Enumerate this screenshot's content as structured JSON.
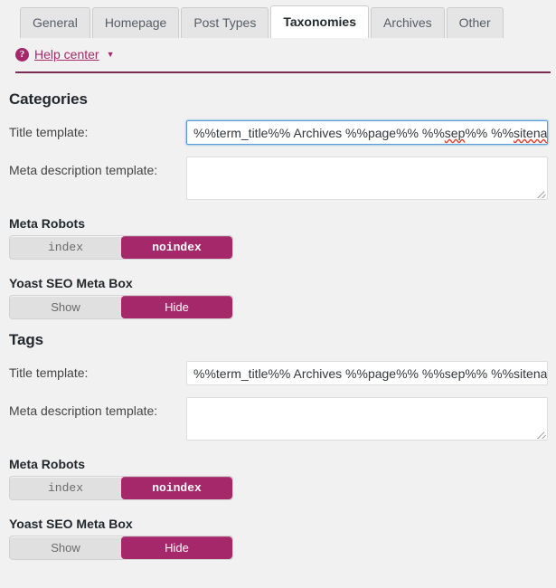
{
  "tabs": [
    {
      "label": "General",
      "active": false
    },
    {
      "label": "Homepage",
      "active": false
    },
    {
      "label": "Post Types",
      "active": false
    },
    {
      "label": "Taxonomies",
      "active": true
    },
    {
      "label": "Archives",
      "active": false
    },
    {
      "label": "Other",
      "active": false
    }
  ],
  "help": {
    "icon": "question-mark-circle-icon",
    "label": "Help center",
    "caret": "▼"
  },
  "colors": {
    "accent": "#a4286a",
    "rule": "#7b2a54",
    "focus_border": "#5b9dd9",
    "page_bg": "#f1f1f1"
  },
  "sections": [
    {
      "id": "categories",
      "title": "Categories",
      "title_template": {
        "label": "Title template:",
        "value_head": "%%term_title%% Archives %%page%% %%",
        "value_sep": "sep",
        "value_mid": "%% %%",
        "value_tail": "sitenam",
        "full_value": "%%term_title%% Archives %%page%% %%sep%% %%sitename%%",
        "focused": true
      },
      "meta_description": {
        "label": "Meta description template:",
        "value": ""
      },
      "meta_robots": {
        "title": "Meta Robots",
        "options": [
          "index",
          "noindex"
        ],
        "selected": "noindex"
      },
      "meta_box": {
        "title": "Yoast SEO Meta Box",
        "options": [
          "Show",
          "Hide"
        ],
        "selected": "Hide"
      }
    },
    {
      "id": "tags",
      "title": "Tags",
      "title_template": {
        "label": "Title template:",
        "value_head": "%%term_title%% Archives %%page%% %%sep%% %%sitenam",
        "value_sep": "",
        "value_mid": "",
        "value_tail": "",
        "full_value": "%%term_title%% Archives %%page%% %%sep%% %%sitename%%",
        "focused": false
      },
      "meta_description": {
        "label": "Meta description template:",
        "value": ""
      },
      "meta_robots": {
        "title": "Meta Robots",
        "options": [
          "index",
          "noindex"
        ],
        "selected": "noindex"
      },
      "meta_box": {
        "title": "Yoast SEO Meta Box",
        "options": [
          "Show",
          "Hide"
        ],
        "selected": "Hide"
      }
    }
  ]
}
